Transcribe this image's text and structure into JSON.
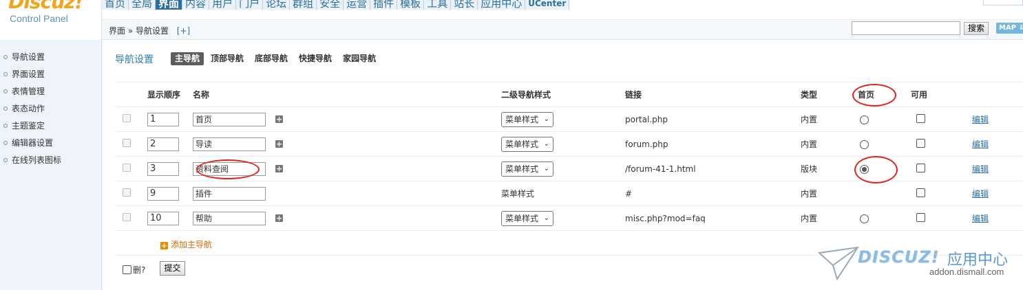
{
  "logo": {
    "brand": "Discuz!",
    "subtitle": "Control Panel"
  },
  "top_menu": [
    {
      "label": "首页"
    },
    {
      "label": "全局"
    },
    {
      "label": "界面",
      "active": true
    },
    {
      "label": "内容"
    },
    {
      "label": "用户"
    },
    {
      "label": "门户"
    },
    {
      "label": "论坛"
    },
    {
      "label": "群组"
    },
    {
      "label": "安全"
    },
    {
      "label": "运营"
    },
    {
      "label": "插件"
    },
    {
      "label": "模板"
    },
    {
      "label": "工具"
    },
    {
      "label": "站长"
    },
    {
      "label": "应用中心"
    },
    {
      "label": "UCenter"
    }
  ],
  "breadcrumb": {
    "path": "界面 » 导航设置",
    "add": "[+]"
  },
  "search": {
    "value": "",
    "button": "搜索",
    "map_button": "MAP ⇓"
  },
  "sidebar": {
    "items": [
      {
        "label": "导航设置"
      },
      {
        "label": "界面设置"
      },
      {
        "label": "表情管理"
      },
      {
        "label": "表态动作"
      },
      {
        "label": "主题鉴定"
      },
      {
        "label": "编辑器设置"
      },
      {
        "label": "在线列表图标"
      }
    ]
  },
  "main": {
    "title": "导航设置",
    "tabs": [
      {
        "label": "主导航",
        "active": true
      },
      {
        "label": "顶部导航"
      },
      {
        "label": "底部导航"
      },
      {
        "label": "快捷导航"
      },
      {
        "label": "家园导航"
      }
    ],
    "columns": [
      "显示顺序",
      "名称",
      "二级导航样式",
      "链接",
      "类型",
      "首页",
      "可用"
    ],
    "rows": [
      {
        "order": "1",
        "name": "首页",
        "has_sub": true,
        "sub_style": "菜单样式",
        "link": "portal.php",
        "type": "内置",
        "home": false,
        "edit": "编辑"
      },
      {
        "order": "2",
        "name": "导读",
        "has_sub": true,
        "sub_style": "菜单样式",
        "link": "forum.php",
        "type": "内置",
        "home": false,
        "edit": "编辑"
      },
      {
        "order": "3",
        "name": "资料查阅",
        "has_sub": true,
        "sub_style": "菜单样式",
        "link": "/forum-41-1.html",
        "type": "版块",
        "home": true,
        "edit": "编辑"
      },
      {
        "order": "9",
        "name": "插件",
        "has_sub": false,
        "sub_style": "菜单样式",
        "link": "#",
        "type": "内置",
        "home": false,
        "edit": "编辑"
      },
      {
        "order": "10",
        "name": "帮助",
        "has_sub": true,
        "sub_style": "菜单样式",
        "link": "misc.php?mod=faq",
        "type": "内置",
        "home": false,
        "edit": "编辑"
      }
    ],
    "add_label": "添加主导航",
    "delete_label": "删?",
    "submit_label": "提交"
  },
  "watermark": {
    "brand": "DISCUZ!",
    "cn": "应用中心",
    "url": "addon.dismall.com"
  },
  "colors": {
    "accent": "#2b6ea4",
    "annotation": "#e0231b",
    "add": "#d66b00"
  }
}
